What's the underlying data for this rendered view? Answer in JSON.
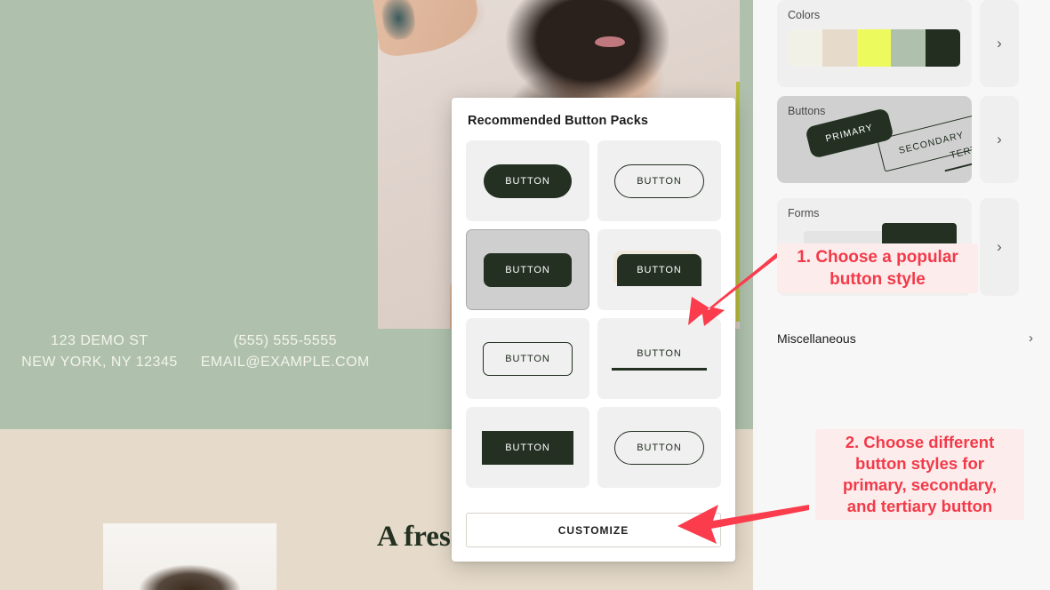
{
  "site_preview": {
    "contact": {
      "left_line1": "123 DEMO ST",
      "left_line2": "NEW YORK, NY 12345",
      "right_line1": "(555) 555-5555",
      "right_line2": "EMAIL@EXAMPLE.COM"
    },
    "bottom_heading": "A fres",
    "bottom_sub": "",
    "colors": {
      "hero_background": "#afc1ad",
      "beige_band": "#e6dbca",
      "heading_green": "#233022",
      "accent_yellow": "#b9bd3a"
    }
  },
  "modal": {
    "title": "Recommended Button Packs",
    "packs": [
      {
        "id": "pill-filled",
        "label": "BUTTON",
        "style": "pill-filled",
        "selected": false
      },
      {
        "id": "pill-outline",
        "label": "BUTTON",
        "style": "pill-outline",
        "selected": false
      },
      {
        "id": "rounded-filled",
        "label": "BUTTON",
        "style": "rounded-filled",
        "selected": true
      },
      {
        "id": "offset-filled",
        "label": "BUTTON",
        "style": "offset-filled",
        "selected": false
      },
      {
        "id": "rect-outline",
        "label": "BUTTON",
        "style": "rect-outline",
        "selected": false
      },
      {
        "id": "underline",
        "label": "BUTTON",
        "style": "underline",
        "selected": false
      },
      {
        "id": "square-filled",
        "label": "BUTTON",
        "style": "square-filled",
        "selected": false
      },
      {
        "id": "pill-outline-2",
        "label": "BUTTON",
        "style": "pill-outline",
        "selected": false
      }
    ],
    "customize_label": "CUSTOMIZE"
  },
  "sidebar": {
    "sections": [
      {
        "id": "colors",
        "title": "Colors",
        "highlighted": false,
        "swatches": [
          "#f2f1e8",
          "#e6dbca",
          "#ecfa5e",
          "#afc1ad",
          "#232d20"
        ]
      },
      {
        "id": "buttons",
        "title": "Buttons",
        "highlighted": true,
        "previews": [
          {
            "label": "PRIMARY",
            "style": "filled"
          },
          {
            "label": "SECONDARY",
            "style": "outline"
          },
          {
            "label": "TERTIARY",
            "style": "underline"
          }
        ]
      },
      {
        "id": "forms",
        "title": "Forms",
        "highlighted": false
      }
    ],
    "chevron_glyph": "›",
    "miscellaneous": {
      "label": "Miscellaneous",
      "chevron_glyph": "›"
    }
  },
  "annotations": {
    "highlight_color": "#fa3c4c",
    "callout_1": "1. Choose a popular button style",
    "callout_1_line1": "1. Choose a popular",
    "callout_1_line2": "button style",
    "callout_2_line1": "2. Choose different",
    "callout_2_line2": "button styles for",
    "callout_2_line3": "primary, secondary,",
    "callout_2_line4": "and tertiary button"
  }
}
